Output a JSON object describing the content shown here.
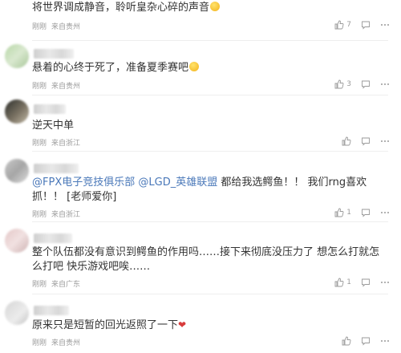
{
  "comments": [
    {
      "text": "将世界调成静音，聆听皇杂心碎的声音",
      "time": "刚刚",
      "source": "来自贵州",
      "likes": "7"
    },
    {
      "text": "悬着的心终于死了，准备夏季赛吧",
      "time": "刚刚",
      "source": "来自贵州",
      "likes": "3"
    },
    {
      "text": "逆天中单",
      "time": "刚刚",
      "source": "来自浙江",
      "likes": ""
    },
    {
      "mention1": "@FPX电子竞技俱乐部",
      "mention2": "@LGD_英雄联盟",
      "text_a": " 都给我选鳄鱼！！ 我们rng喜欢",
      "text_b": "抓！！ [老师爱你]",
      "time": "刚刚",
      "source": "来自浙江",
      "likes": "1"
    },
    {
      "text_a": "整个队伍都没有意识到鳄鱼的作用吗……接下来彻底没压力了 想怎么打就怎",
      "text_b": "么打吧 快乐游戏吧唉……",
      "time": "刚刚",
      "source": "来自广东",
      "likes": "1"
    },
    {
      "text": "原来只是短暂的回光返照了一下",
      "time": "刚刚",
      "source": "来自贵州",
      "likes": ""
    }
  ],
  "icons": {
    "like": "thumbs-up-icon",
    "reply": "comment-bubble-icon",
    "more": "more-dots-icon"
  }
}
